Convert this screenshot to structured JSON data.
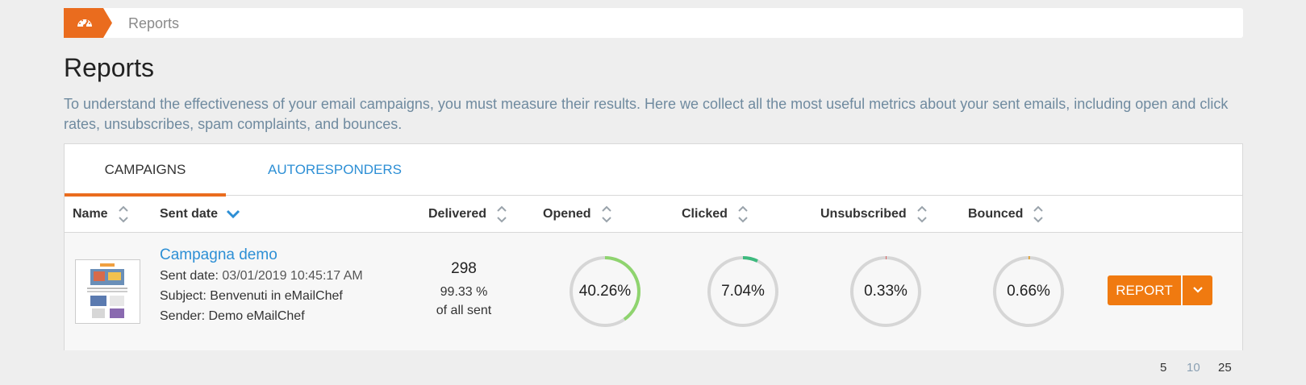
{
  "breadcrumb": {
    "home_icon": "dashboard-gauge-icon",
    "current": "Reports",
    "accent": "#ea6c1e"
  },
  "page": {
    "title": "Reports",
    "description": "To understand the effectiveness of your email campaigns, you must measure their results. Here we collect all the most useful metrics about your sent emails, including open and click rates, unsubscribes, spam complaints, and bounces."
  },
  "tabs": [
    {
      "label": "CAMPAIGNS",
      "active": true
    },
    {
      "label": "AUTORESPONDERS",
      "active": false
    }
  ],
  "columns": {
    "name": "Name",
    "sent_date": "Sent date",
    "delivered": "Delivered",
    "opened": "Opened",
    "clicked": "Clicked",
    "unsubscribed": "Unsubscribed",
    "bounced": "Bounced"
  },
  "rows": [
    {
      "name": "Campagna demo",
      "sent_date_label": "Sent date: ",
      "sent_date": "03/01/2019 10:45:17 AM",
      "subject_label": "Subject: ",
      "subject": "Benvenuti in eMailChef",
      "sender_label": "Sender: ",
      "sender": "Demo eMailChef",
      "delivered": "298",
      "delivered_pct": "99.33 %",
      "delivered_note": "of all sent",
      "opened": {
        "label": "40.26%",
        "value": 40.26,
        "color": "#8fd46f"
      },
      "clicked": {
        "label": "7.04%",
        "value": 7.04,
        "color": "#3dba7e"
      },
      "unsubscribed": {
        "label": "0.33%",
        "value": 0.33,
        "color": "#e05050"
      },
      "bounced": {
        "label": "0.66%",
        "value": 0.66,
        "color": "#e0a030"
      },
      "report_button": "REPORT"
    }
  ],
  "page_sizes": [
    "5",
    "10",
    "25"
  ]
}
